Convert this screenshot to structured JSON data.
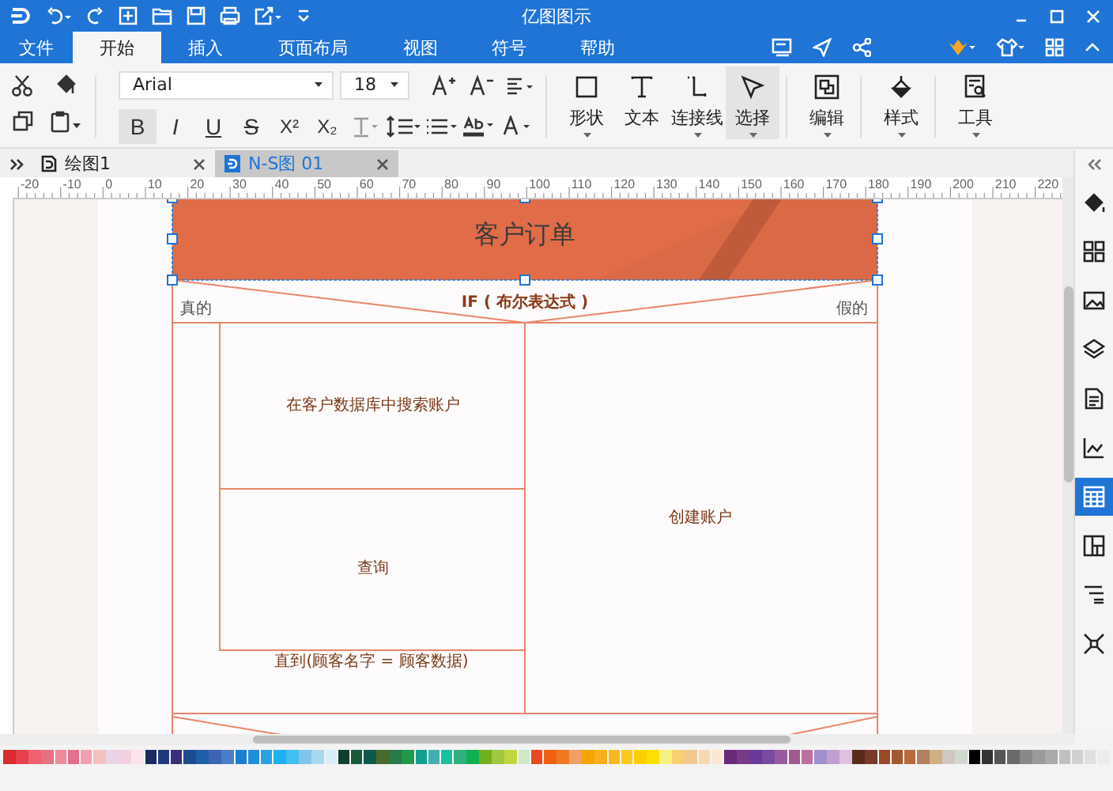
{
  "title_bar": {
    "title": "亿图图示"
  },
  "menu_tabs": [
    {
      "label": "文件",
      "selected": false
    },
    {
      "label": "开始",
      "selected": true
    },
    {
      "label": "插入",
      "selected": false
    },
    {
      "label": "页面布局",
      "selected": false
    },
    {
      "label": "视图",
      "selected": false
    },
    {
      "label": "符号",
      "selected": false
    },
    {
      "label": "帮助",
      "selected": false
    }
  ],
  "ribbon": {
    "font_field": {
      "value": "Arial"
    },
    "size_field": {
      "value": "18"
    },
    "format_buttons": [
      {
        "label": "B",
        "kind": "bold",
        "selected": true
      },
      {
        "label": "I",
        "kind": "italic",
        "selected": false
      },
      {
        "label": "U",
        "kind": "underline",
        "selected": false
      },
      {
        "label": "S",
        "kind": "strike",
        "selected": false
      },
      {
        "label": "X²",
        "kind": "sup",
        "selected": false
      },
      {
        "label": "X₂",
        "kind": "sub",
        "selected": false
      }
    ],
    "tools": [
      {
        "label": "形状",
        "kind": "shape",
        "selected": false,
        "has_menu": true
      },
      {
        "label": "文本",
        "kind": "text",
        "selected": false,
        "has_menu": false
      },
      {
        "label": "连接线",
        "kind": "connector",
        "selected": false,
        "has_menu": true
      },
      {
        "label": "选择",
        "kind": "select",
        "selected": true,
        "has_menu": true
      },
      {
        "label": "编辑",
        "kind": "edit",
        "selected": false,
        "has_menu": true
      },
      {
        "label": "样式",
        "kind": "style",
        "selected": false,
        "has_menu": true
      },
      {
        "label": "工具",
        "kind": "tools",
        "selected": false,
        "has_menu": true
      }
    ]
  },
  "documents": [
    {
      "label": "绘图1",
      "selected": false
    },
    {
      "label": "N-S图 01",
      "selected": true
    }
  ],
  "ruler": {
    "ticks": [
      "-20",
      "-10",
      "0",
      "10",
      "20",
      "30",
      "40",
      "50",
      "60",
      "70",
      "80",
      "90",
      "100",
      "110",
      "120",
      "130",
      "140",
      "150",
      "160",
      "170",
      "180",
      "190",
      "200",
      "210",
      "220"
    ]
  },
  "diagram": {
    "title": "客户订单",
    "condition": "IF ( 布尔表达式 )",
    "true_label": "真的",
    "false_label": "假的",
    "loop_body": "在客户数据库中搜索账户",
    "loop_step": "查询",
    "loop_condition": "直到(顾客名字 = 顾客数据)",
    "false_branch": "创建账户"
  },
  "side_panel": {
    "items": [
      {
        "kind": "fill",
        "selected": false
      },
      {
        "kind": "grid",
        "selected": false
      },
      {
        "kind": "image",
        "selected": false
      },
      {
        "kind": "layers",
        "selected": false
      },
      {
        "kind": "page",
        "selected": false
      },
      {
        "kind": "chart",
        "selected": false
      },
      {
        "kind": "table",
        "selected": true
      },
      {
        "kind": "blocks",
        "selected": false
      },
      {
        "kind": "outline",
        "selected": false
      },
      {
        "kind": "nodes",
        "selected": false
      }
    ]
  },
  "palette": {
    "colors": [
      {
        "color": "#d92b2b"
      },
      {
        "color": "#e8404a"
      },
      {
        "color": "#f06070"
      },
      {
        "color": "#e87080"
      },
      {
        "color": "#f08a9a"
      },
      {
        "color": "#e66e8f"
      },
      {
        "color": "#f0a0b0"
      },
      {
        "color": "#f5c0c0"
      },
      {
        "color": "#e9d3e6"
      },
      {
        "color": "#f3d0e0"
      },
      {
        "color": "#fbe3ea"
      },
      {
        "color": "#1a2a5e"
      },
      {
        "color": "#1f3a7a"
      },
      {
        "color": "#3a2f7a"
      },
      {
        "color": "#1e4b8f"
      },
      {
        "color": "#1f5fa8"
      },
      {
        "color": "#3d64b5"
      },
      {
        "color": "#4a7fc4"
      },
      {
        "color": "#1a7fd0"
      },
      {
        "color": "#1f8fd8"
      },
      {
        "color": "#2aa0e0"
      },
      {
        "color": "#1fb0f0"
      },
      {
        "color": "#40c0f0"
      },
      {
        "color": "#80c4ec"
      },
      {
        "color": "#a8d8f0"
      },
      {
        "color": "#d8eef8"
      },
      {
        "color": "#0f3f2f"
      },
      {
        "color": "#1a5a3a"
      },
      {
        "color": "#0e5a4a"
      },
      {
        "color": "#4a6a2a"
      },
      {
        "color": "#2a7a4a"
      },
      {
        "color": "#1f9a4a"
      },
      {
        "color": "#10a090"
      },
      {
        "color": "#40b0b0"
      },
      {
        "color": "#18c0a0"
      },
      {
        "color": "#30b080"
      },
      {
        "color": "#10b050"
      },
      {
        "color": "#70b020"
      },
      {
        "color": "#a0c840"
      },
      {
        "color": "#c0d840"
      },
      {
        "color": "#d0e8c8"
      },
      {
        "color": "#e84a20"
      },
      {
        "color": "#f06010"
      },
      {
        "color": "#f07820"
      },
      {
        "color": "#f0a060"
      },
      {
        "color": "#f5a500"
      },
      {
        "color": "#f8b020"
      },
      {
        "color": "#fab820"
      },
      {
        "color": "#fcc820"
      },
      {
        "color": "#fcd000"
      },
      {
        "color": "#fce000"
      },
      {
        "color": "#f8f080"
      },
      {
        "color": "#f8d070"
      },
      {
        "color": "#f0c890"
      },
      {
        "color": "#f8d8b0"
      },
      {
        "color": "#fce8d0"
      },
      {
        "color": "#6a2a7a"
      },
      {
        "color": "#7a3a8a"
      },
      {
        "color": "#6a3a9a"
      },
      {
        "color": "#7a4aa0"
      },
      {
        "color": "#9a5aa0"
      },
      {
        "color": "#a05a90"
      },
      {
        "color": "#c070a0"
      },
      {
        "color": "#a090d0"
      },
      {
        "color": "#c0a0d0"
      },
      {
        "color": "#e0c0e0"
      },
      {
        "color": "#5a2a1a"
      },
      {
        "color": "#7a3a2a"
      },
      {
        "color": "#9a4a2a"
      },
      {
        "color": "#a05a30"
      },
      {
        "color": "#b86a3a"
      },
      {
        "color": "#b08060"
      },
      {
        "color": "#d0b080"
      },
      {
        "color": "#d0c8c0"
      },
      {
        "color": "#d0d8d0"
      },
      {
        "color": "#000000"
      },
      {
        "color": "#333333"
      },
      {
        "color": "#555555"
      },
      {
        "color": "#6a6a6a"
      },
      {
        "color": "#888888"
      },
      {
        "color": "#9a9a9a"
      },
      {
        "color": "#aaaaaa"
      },
      {
        "color": "#c0c0c0"
      },
      {
        "color": "#d0d0d0"
      },
      {
        "color": "#e0e0e0"
      },
      {
        "color": "#ececec"
      }
    ]
  }
}
